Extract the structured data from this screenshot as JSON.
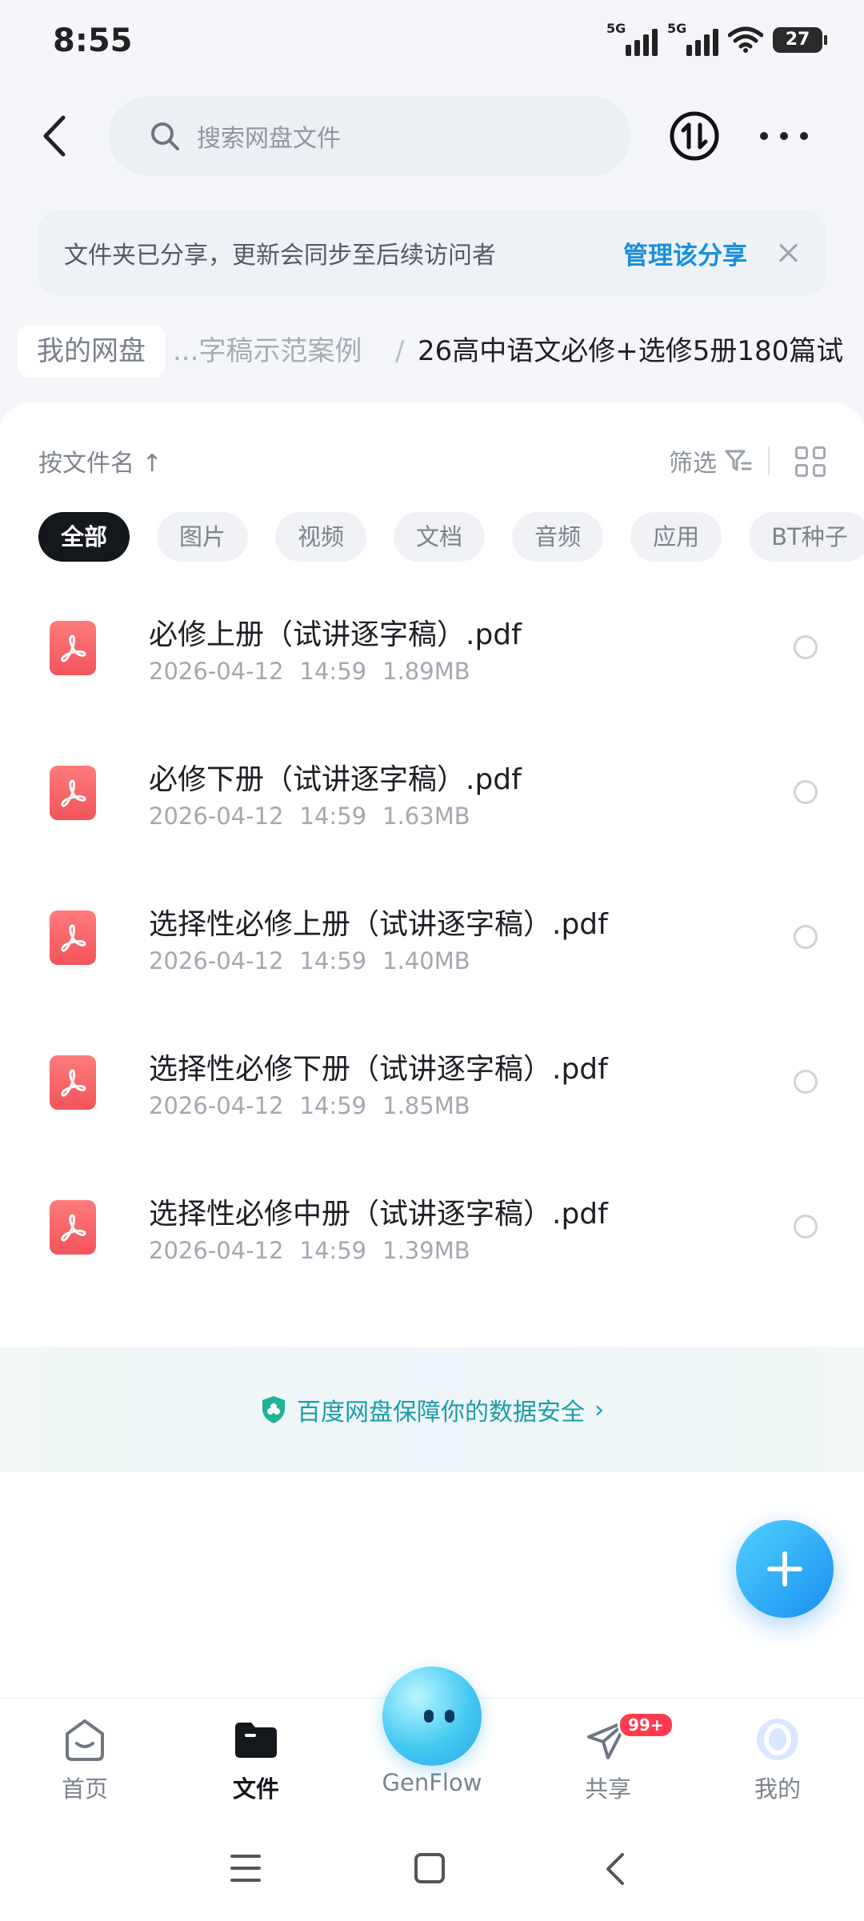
{
  "status_bar": {
    "time": "8:55",
    "signal1_label": "5G",
    "signal2_label": "5G",
    "battery": "27"
  },
  "header": {
    "search_placeholder": "搜索网盘文件"
  },
  "share_banner": {
    "message": "文件夹已分享，更新会同步至后续访问者",
    "action": "管理该分享"
  },
  "breadcrumb": {
    "root": "我的网盘",
    "middle": "...字稿示范案例",
    "separator": "/",
    "current": "26高中语文必修+选修5册180篇试"
  },
  "toolbar": {
    "sort_label": "按文件名 ↑",
    "filter_label": "筛选"
  },
  "filter_chips": [
    "全部",
    "图片",
    "视频",
    "文档",
    "音频",
    "应用",
    "BT种子"
  ],
  "files": [
    {
      "name": "必修上册（试讲逐字稿）.pdf",
      "date": "2026-04-12",
      "time": "14:59",
      "size": "1.89MB"
    },
    {
      "name": "必修下册（试讲逐字稿）.pdf",
      "date": "2026-04-12",
      "time": "14:59",
      "size": "1.63MB"
    },
    {
      "name": "选择性必修上册（试讲逐字稿）.pdf",
      "date": "2026-04-12",
      "time": "14:59",
      "size": "1.40MB"
    },
    {
      "name": "选择性必修下册（试讲逐字稿）.pdf",
      "date": "2026-04-12",
      "time": "14:59",
      "size": "1.85MB"
    },
    {
      "name": "选择性必修中册（试讲逐字稿）.pdf",
      "date": "2026-04-12",
      "time": "14:59",
      "size": "1.39MB"
    }
  ],
  "safety": {
    "text": "百度网盘保障你的数据安全"
  },
  "tabbar": {
    "home": "首页",
    "files": "文件",
    "genflow": "GenFlow",
    "share": "共享",
    "share_badge": "99+",
    "me": "我的"
  },
  "colors": {
    "accent": "#1a8fdd",
    "pdf_icon": "#f2545b",
    "safety_text": "#1a9ea6",
    "fab": "#1b8ff0"
  }
}
